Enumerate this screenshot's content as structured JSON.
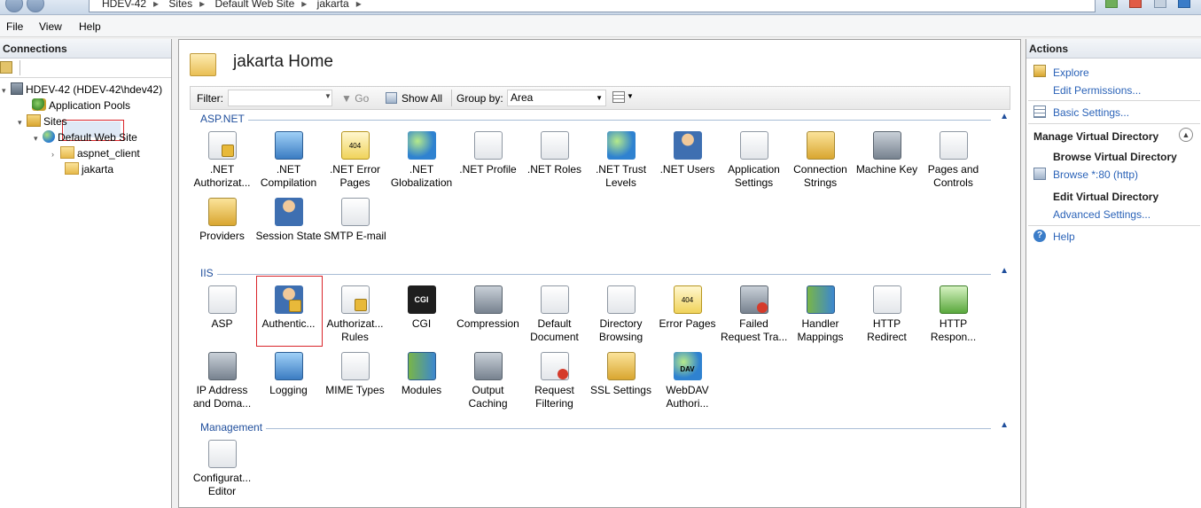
{
  "window": {
    "breadcrumb": [
      "HDEV-42",
      "Sites",
      "Default Web Site",
      "jakarta"
    ]
  },
  "menu": {
    "file": "File",
    "view": "View",
    "help": "Help"
  },
  "connections": {
    "header": "Connections",
    "tree": [
      {
        "label": "HDEV-42 (HDEV-42\\hdev42)",
        "icon": "server-icon"
      },
      {
        "label": "Application Pools",
        "icon": "app-pools-icon"
      },
      {
        "label": "Sites",
        "icon": "sites-icon"
      },
      {
        "label": "Default Web Site",
        "icon": "globe-icon"
      },
      {
        "label": "aspnet_client",
        "icon": "folder-icon"
      },
      {
        "label": "jakarta",
        "icon": "folder-icon",
        "selected": true
      }
    ]
  },
  "main": {
    "title": "jakarta Home",
    "filter": {
      "label": "Filter:",
      "value": "",
      "go": "Go",
      "show_all": "Show All",
      "group_by_label": "Group by:",
      "group_by_value": "Area"
    },
    "sections": [
      {
        "name": "ASP.NET",
        "features": [
          {
            "label": ".NET",
            "label2": "Authorizat...",
            "icon": "net-authorization-icon"
          },
          {
            "label": ".NET",
            "label2": "Compilation",
            "icon": "net-compilation-icon"
          },
          {
            "label": ".NET Error",
            "label2": "Pages",
            "icon": "net-error-pages-icon"
          },
          {
            "label": ".NET",
            "label2": "Globalization",
            "icon": "net-globalization-icon"
          },
          {
            "label": ".NET Profile",
            "label2": "",
            "icon": "net-profile-icon"
          },
          {
            "label": ".NET Roles",
            "label2": "",
            "icon": "net-roles-icon"
          },
          {
            "label": ".NET Trust",
            "label2": "Levels",
            "icon": "net-trust-levels-icon"
          },
          {
            "label": ".NET Users",
            "label2": "",
            "icon": "net-users-icon"
          },
          {
            "label": "Application",
            "label2": "Settings",
            "icon": "application-settings-icon"
          },
          {
            "label": "Connection",
            "label2": "Strings",
            "icon": "connection-strings-icon"
          },
          {
            "label": "Machine Key",
            "label2": "",
            "icon": "machine-key-icon"
          },
          {
            "label": "Pages and",
            "label2": "Controls",
            "icon": "pages-controls-icon"
          },
          {
            "label": "Providers",
            "label2": "",
            "icon": "providers-icon"
          },
          {
            "label": "Session State",
            "label2": "",
            "icon": "session-state-icon"
          },
          {
            "label": "SMTP E-mail",
            "label2": "",
            "icon": "smtp-email-icon"
          }
        ]
      },
      {
        "name": "IIS",
        "features": [
          {
            "label": "ASP",
            "label2": "",
            "icon": "asp-icon"
          },
          {
            "label": "Authentic...",
            "label2": "",
            "icon": "authentication-icon",
            "highlighted": true
          },
          {
            "label": "Authorizat...",
            "label2": "Rules",
            "icon": "authorization-rules-icon"
          },
          {
            "label": "CGI",
            "label2": "",
            "icon": "cgi-icon",
            "text": "CGI"
          },
          {
            "label": "Compression",
            "label2": "",
            "icon": "compression-icon"
          },
          {
            "label": "Default",
            "label2": "Document",
            "icon": "default-document-icon"
          },
          {
            "label": "Directory",
            "label2": "Browsing",
            "icon": "directory-browsing-icon"
          },
          {
            "label": "Error Pages",
            "label2": "",
            "icon": "error-pages-icon"
          },
          {
            "label": "Failed",
            "label2": "Request Tra...",
            "icon": "failed-request-tracing-icon"
          },
          {
            "label": "Handler",
            "label2": "Mappings",
            "icon": "handler-mappings-icon"
          },
          {
            "label": "HTTP",
            "label2": "Redirect",
            "icon": "http-redirect-icon"
          },
          {
            "label": "HTTP",
            "label2": "Respon...",
            "icon": "http-response-headers-icon"
          },
          {
            "label": "IP Address",
            "label2": "and Doma...",
            "icon": "ip-address-icon"
          },
          {
            "label": "Logging",
            "label2": "",
            "icon": "logging-icon"
          },
          {
            "label": "MIME Types",
            "label2": "",
            "icon": "mime-types-icon"
          },
          {
            "label": "Modules",
            "label2": "",
            "icon": "modules-icon"
          },
          {
            "label": "Output",
            "label2": "Caching",
            "icon": "output-caching-icon"
          },
          {
            "label": "Request",
            "label2": "Filtering",
            "icon": "request-filtering-icon"
          },
          {
            "label": "SSL Settings",
            "label2": "",
            "icon": "ssl-settings-icon"
          },
          {
            "label": "WebDAV",
            "label2": "Authori...",
            "icon": "webdav-icon",
            "text": "DAV"
          }
        ]
      },
      {
        "name": "Management",
        "features": [
          {
            "label": "Configurat...",
            "label2": "Editor",
            "icon": "configuration-editor-icon"
          }
        ]
      }
    ],
    "error_badge": "404"
  },
  "actions": {
    "header": "Actions",
    "explore": "Explore",
    "edit_permissions": "Edit Permissions...",
    "basic_settings": "Basic Settings...",
    "manage_group": "Manage Virtual Directory",
    "browse_header": "Browse Virtual Directory",
    "browse_link": "Browse *:80 (http)",
    "edit_header": "Edit Virtual Directory",
    "advanced_settings": "Advanced Settings...",
    "help": "Help"
  }
}
